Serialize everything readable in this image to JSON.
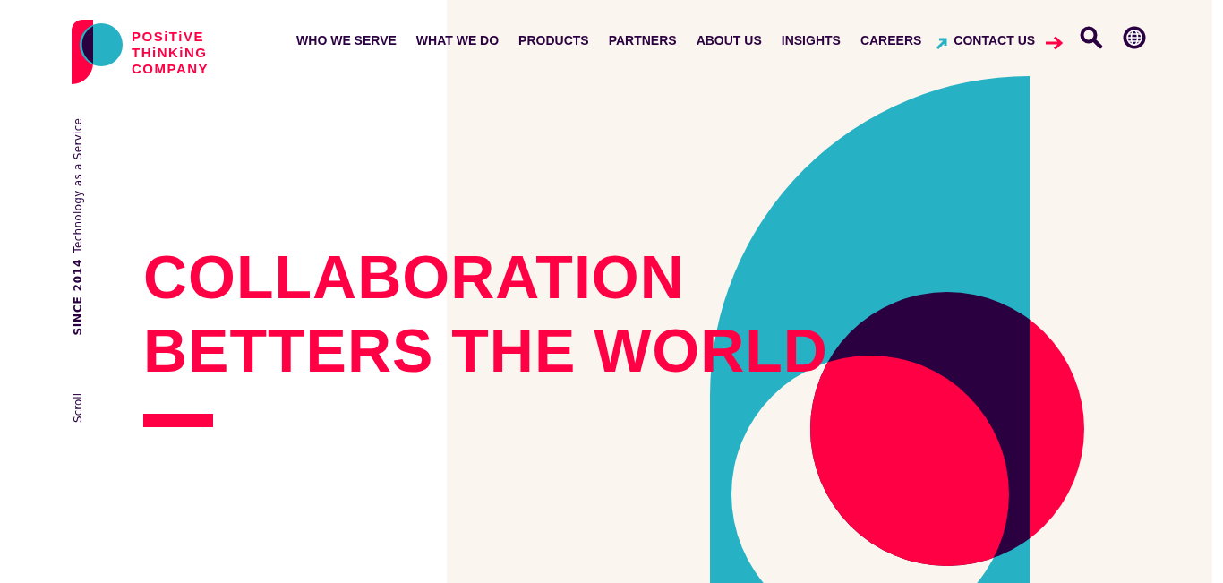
{
  "logo": {
    "lines": [
      "POSiTiVE",
      "THiNKiNG",
      "COMPANY"
    ]
  },
  "nav": [
    {
      "label": "WHO WE SERVE",
      "kind": "link"
    },
    {
      "label": "WHAT WE DO",
      "kind": "link"
    },
    {
      "label": "PRODUCTS",
      "kind": "link"
    },
    {
      "label": "PARTNERS",
      "kind": "link"
    },
    {
      "label": "ABOUT US",
      "kind": "link"
    },
    {
      "label": "INSIGHTS",
      "kind": "link"
    },
    {
      "label": "CAREERS",
      "kind": "link"
    },
    {
      "label": "CONTACT US",
      "kind": "cta"
    }
  ],
  "side": {
    "tagline": "Technology as a Service",
    "since": "SINCE 2014",
    "scroll": "Scroll"
  },
  "hero": {
    "lines": [
      "COLLABORATION",
      "BETTERS THE WORLD"
    ]
  }
}
